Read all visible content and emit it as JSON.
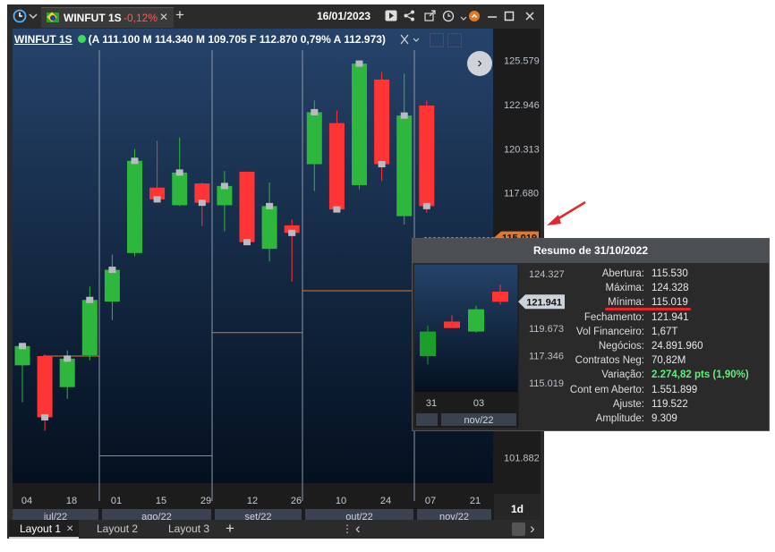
{
  "title_bar": {
    "symbol": "WINFUT 1S",
    "change": "-0,12%",
    "close_glyph": "✕",
    "plus_glyph": "+",
    "date": "16/01/2023",
    "icons": [
      "clock-icon",
      "chevron-down-icon",
      "play-icon",
      "share-icon",
      "export-icon",
      "history-icon",
      "settings-icon",
      "minimize-icon",
      "maximize-icon",
      "close-icon"
    ]
  },
  "header": {
    "symbol": "WINFUT 1S",
    "ohlc": "(A 111.100 M 114.340 M 109.705 F 112.870 0,79% A 112.973)"
  },
  "nav_glyph": "›",
  "colors": {
    "up": "#2db83d",
    "down": "#ff3535",
    "price_tag": "#e0782a",
    "bg_top": "#25436a",
    "bg_bottom": "#04101f"
  },
  "chart_data": {
    "type": "candlestick",
    "period": "1d",
    "y_ticks": [
      "125.579",
      "122.946",
      "120.313",
      "117.680",
      "101.882"
    ],
    "ylim": [
      100800,
      126900
    ],
    "last_price": "115.019",
    "x_day_labels": [
      "04",
      "18",
      "01",
      "15",
      "29",
      "12",
      "26",
      "10",
      "24",
      "07",
      "21"
    ],
    "month_labels": [
      "jul/22",
      "ago/22",
      "set/22",
      "out/22",
      "nov/22"
    ],
    "candles": [
      {
        "o": 107400,
        "h": 108200,
        "l": 105200,
        "c": 108550
      },
      {
        "o": 107950,
        "h": 108050,
        "l": 103500,
        "c": 104300
      },
      {
        "o": 106100,
        "h": 108300,
        "l": 105400,
        "c": 107800
      },
      {
        "o": 108000,
        "h": 112100,
        "l": 107700,
        "c": 111300
      },
      {
        "o": 111200,
        "h": 114000,
        "l": 110100,
        "c": 113100
      },
      {
        "o": 114100,
        "h": 120300,
        "l": 113900,
        "c": 119600
      },
      {
        "o": 118000,
        "h": 120800,
        "l": 117250,
        "c": 117300
      },
      {
        "o": 116950,
        "h": 121000,
        "l": 116900,
        "c": 118900
      },
      {
        "o": 118250,
        "h": 118300,
        "l": 115700,
        "c": 117100
      },
      {
        "o": 116950,
        "h": 119000,
        "l": 115400,
        "c": 118100
      },
      {
        "o": 118950,
        "h": 118950,
        "l": 115900,
        "c": 114750
      },
      {
        "o": 114350,
        "h": 118300,
        "l": 113600,
        "c": 116900
      },
      {
        "o": 115750,
        "h": 116100,
        "l": 112400,
        "c": 115300
      },
      {
        "o": 119400,
        "h": 123200,
        "l": 117800,
        "c": 122500
      },
      {
        "o": 121850,
        "h": 122600,
        "l": 117200,
        "c": 116700
      },
      {
        "o": 118150,
        "h": 125600,
        "l": 117900,
        "c": 125400
      },
      {
        "o": 124450,
        "h": 124900,
        "l": 118400,
        "c": 119400
      },
      {
        "o": 116300,
        "h": 124800,
        "l": 115800,
        "c": 122300
      },
      {
        "o": 122900,
        "h": 123200,
        "l": 116500,
        "c": 116900
      }
    ],
    "ref_levels": [
      102000,
      109350,
      111850
    ],
    "summary": {
      "title": "Resumo de 31/10/2022",
      "mini_y_ticks": [
        "124.327",
        "121.941",
        "119.673",
        "117.346",
        "115.019"
      ],
      "mini_tag": "121.941",
      "mini_x_labels": [
        "31",
        "03"
      ],
      "mini_month": "nov/22",
      "rows": [
        {
          "label": "Abertura:",
          "value": "115.530"
        },
        {
          "label": "Máxima:",
          "value": "124.328"
        },
        {
          "label": "Mínima:",
          "value": "115.019"
        },
        {
          "label": "Fechamento:",
          "value": "121.941"
        },
        {
          "label": "Vol Financeiro:",
          "value": "1,67T"
        },
        {
          "label": "Negócios:",
          "value": "24.891.960"
        },
        {
          "label": "Contratos Neg:",
          "value": "70,82M"
        },
        {
          "label": "Variação:",
          "value": "2.274,82 pts (1,90%)"
        },
        {
          "label": "Cont em Aberto:",
          "value": "1.551.899"
        },
        {
          "label": "Ajuste:",
          "value": "119.522"
        },
        {
          "label": "Amplitude:",
          "value": "9.309"
        }
      ],
      "mini_candles": [
        {
          "o": 117300,
          "h": 119900,
          "l": 116600,
          "c": 119400
        },
        {
          "o": 120250,
          "h": 120800,
          "l": 119800,
          "c": 119700
        },
        {
          "o": 119400,
          "h": 121600,
          "l": 119300,
          "c": 121300
        },
        {
          "o": 122800,
          "h": 123400,
          "l": 121700,
          "c": 121941
        }
      ]
    }
  },
  "bottom_bar": {
    "layouts": [
      "Layout 1",
      "Layout 2",
      "Layout 3"
    ],
    "close_glyph": "✕",
    "plus_glyph": "+",
    "menu_glyph": "⋮",
    "left_glyph": "‹",
    "right_glyph": "›"
  }
}
